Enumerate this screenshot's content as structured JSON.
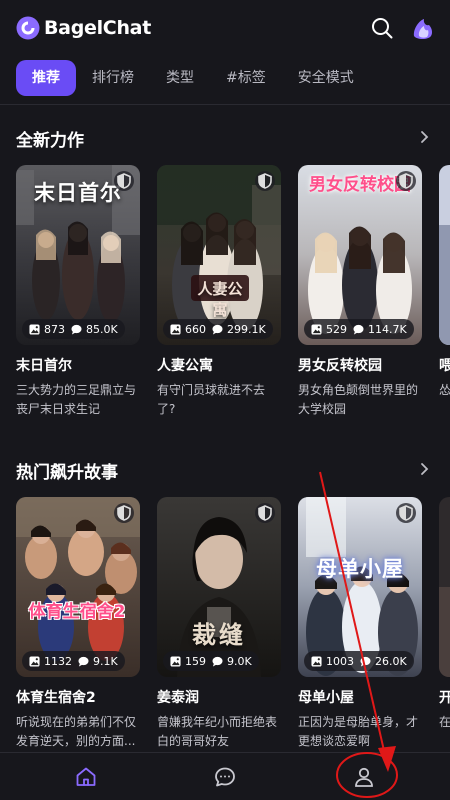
{
  "app": {
    "name": "BagelChat"
  },
  "icons": {
    "logo": "bagelchat-logo-icon",
    "search": "search-icon",
    "brand": "brand-avatar-icon"
  },
  "tabs": [
    {
      "label": "推荐",
      "active": true
    },
    {
      "label": "排行榜",
      "active": false
    },
    {
      "label": "类型",
      "active": false
    },
    {
      "label": "#标签",
      "active": false
    },
    {
      "label": "安全模式",
      "active": false
    }
  ],
  "sections": [
    {
      "title": "全新力作",
      "cards": [
        {
          "title": "末日首尔",
          "cover_text": "末日首尔",
          "images": "873",
          "comments": "85.0K",
          "desc": "三大势力的三足鼎立与丧尸末日求生记"
        },
        {
          "title": "人妻公寓",
          "cover_text": "人妻公寓",
          "images": "660",
          "comments": "299.1K",
          "desc": "有守门员球就进不去了?"
        },
        {
          "title": "男女反转校园",
          "cover_text": "男女反转校园",
          "images": "529",
          "comments": "114.7K",
          "desc": "男女角色颠倒世界里的大学校园"
        },
        {
          "title": "喂",
          "cover_text": "",
          "images": "",
          "comments": "",
          "desc": "怂"
        }
      ]
    },
    {
      "title": "热门飙升故事",
      "cards": [
        {
          "title": "体育生宿舍2",
          "cover_text": "体育生宿舍2",
          "images": "1132",
          "comments": "9.1K",
          "desc": "听说现在的弟弟们不仅发育逆天，别的方面..."
        },
        {
          "title": "姜泰润",
          "cover_text": "裁缝",
          "images": "159",
          "comments": "9.0K",
          "desc": "曾嫌我年纪小而拒绝表白的哥哥好友"
        },
        {
          "title": "母单小屋",
          "cover_text": "母单小屋",
          "images": "1003",
          "comments": "26.0K",
          "desc": "正因为是母胎单身，才更想谈恋爱啊"
        },
        {
          "title": "开",
          "cover_text": "",
          "images": "",
          "comments": "",
          "desc": "在白"
        }
      ]
    }
  ],
  "bottom_nav": [
    {
      "name": "home-icon",
      "active": true
    },
    {
      "name": "chat-icon",
      "active": false
    },
    {
      "name": "profile-icon",
      "active": false
    }
  ],
  "colors": {
    "accent": "#6a4cf5",
    "background": "#17171c",
    "annotation": "#e01818"
  }
}
